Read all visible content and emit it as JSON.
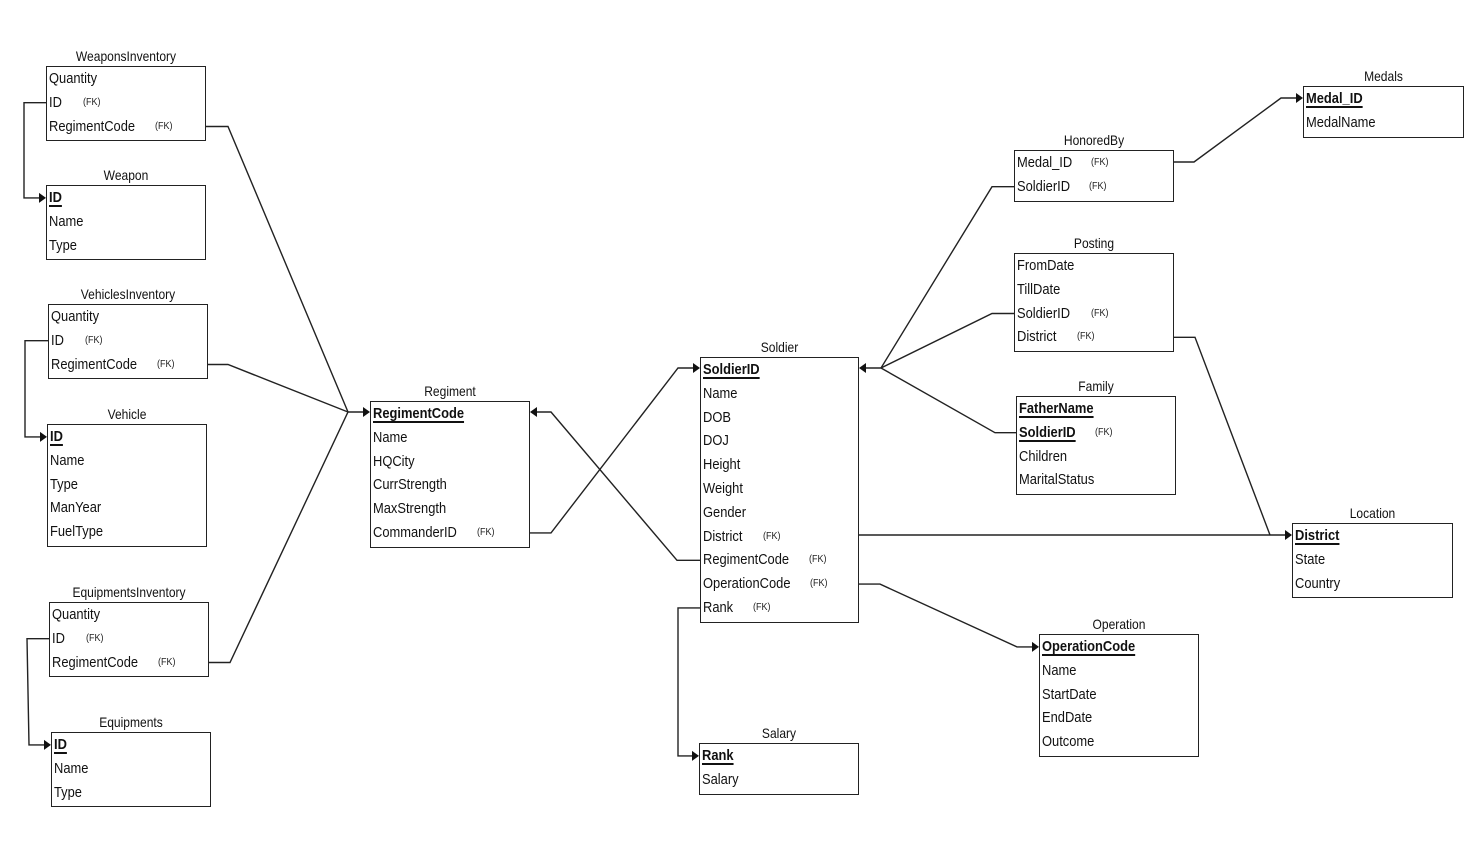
{
  "diagram": {
    "type": "entity-relationship",
    "fk_marker": "(FK)",
    "entities": [
      {
        "id": "weaponsinventory",
        "title": "WeaponsInventory",
        "attributes": [
          {
            "name": "Quantity",
            "pk": false,
            "fk": false
          },
          {
            "name": "ID",
            "pk": false,
            "fk": true
          },
          {
            "name": "RegimentCode",
            "pk": false,
            "fk": true
          }
        ]
      },
      {
        "id": "weapon",
        "title": "Weapon",
        "attributes": [
          {
            "name": "ID",
            "pk": true,
            "fk": false
          },
          {
            "name": "Name",
            "pk": false,
            "fk": false
          },
          {
            "name": "Type",
            "pk": false,
            "fk": false
          }
        ]
      },
      {
        "id": "vehiclesinventory",
        "title": "VehiclesInventory",
        "attributes": [
          {
            "name": "Quantity",
            "pk": false,
            "fk": false
          },
          {
            "name": "ID",
            "pk": false,
            "fk": true
          },
          {
            "name": "RegimentCode",
            "pk": false,
            "fk": true
          }
        ]
      },
      {
        "id": "vehicle",
        "title": "Vehicle",
        "attributes": [
          {
            "name": "ID",
            "pk": true,
            "fk": false
          },
          {
            "name": "Name",
            "pk": false,
            "fk": false
          },
          {
            "name": "Type",
            "pk": false,
            "fk": false
          },
          {
            "name": "ManYear",
            "pk": false,
            "fk": false
          },
          {
            "name": "FuelType",
            "pk": false,
            "fk": false
          }
        ]
      },
      {
        "id": "equipmentsinventory",
        "title": "EquipmentsInventory",
        "attributes": [
          {
            "name": "Quantity",
            "pk": false,
            "fk": false
          },
          {
            "name": "ID",
            "pk": false,
            "fk": true
          },
          {
            "name": "RegimentCode",
            "pk": false,
            "fk": true
          }
        ]
      },
      {
        "id": "equipments",
        "title": "Equipments",
        "attributes": [
          {
            "name": "ID",
            "pk": true,
            "fk": false
          },
          {
            "name": "Name",
            "pk": false,
            "fk": false
          },
          {
            "name": "Type",
            "pk": false,
            "fk": false
          }
        ]
      },
      {
        "id": "regiment",
        "title": "Regiment",
        "attributes": [
          {
            "name": "RegimentCode",
            "pk": true,
            "fk": false
          },
          {
            "name": "Name",
            "pk": false,
            "fk": false
          },
          {
            "name": "HQCity",
            "pk": false,
            "fk": false
          },
          {
            "name": "CurrStrength",
            "pk": false,
            "fk": false
          },
          {
            "name": "MaxStrength",
            "pk": false,
            "fk": false
          },
          {
            "name": "CommanderID",
            "pk": false,
            "fk": true
          }
        ]
      },
      {
        "id": "soldier",
        "title": "Soldier",
        "attributes": [
          {
            "name": "SoldierID",
            "pk": true,
            "fk": false
          },
          {
            "name": "Name",
            "pk": false,
            "fk": false
          },
          {
            "name": "DOB",
            "pk": false,
            "fk": false
          },
          {
            "name": "DOJ",
            "pk": false,
            "fk": false
          },
          {
            "name": "Height",
            "pk": false,
            "fk": false
          },
          {
            "name": "Weight",
            "pk": false,
            "fk": false
          },
          {
            "name": "Gender",
            "pk": false,
            "fk": false
          },
          {
            "name": "District",
            "pk": false,
            "fk": true
          },
          {
            "name": "RegimentCode",
            "pk": false,
            "fk": true
          },
          {
            "name": "OperationCode",
            "pk": false,
            "fk": true
          },
          {
            "name": "Rank",
            "pk": false,
            "fk": true
          }
        ]
      },
      {
        "id": "salary",
        "title": "Salary",
        "attributes": [
          {
            "name": "Rank",
            "pk": true,
            "fk": false
          },
          {
            "name": "Salary",
            "pk": false,
            "fk": false
          }
        ]
      },
      {
        "id": "honoredby",
        "title": "HonoredBy",
        "attributes": [
          {
            "name": "Medal_ID",
            "pk": false,
            "fk": true
          },
          {
            "name": "SoldierID",
            "pk": false,
            "fk": true
          }
        ]
      },
      {
        "id": "medals",
        "title": "Medals",
        "attributes": [
          {
            "name": "Medal_ID",
            "pk": true,
            "fk": false
          },
          {
            "name": "MedalName",
            "pk": false,
            "fk": false
          }
        ]
      },
      {
        "id": "posting",
        "title": "Posting",
        "attributes": [
          {
            "name": "FromDate",
            "pk": false,
            "fk": false
          },
          {
            "name": "TillDate",
            "pk": false,
            "fk": false
          },
          {
            "name": "SoldierID",
            "pk": false,
            "fk": true
          },
          {
            "name": "District",
            "pk": false,
            "fk": true
          }
        ]
      },
      {
        "id": "family",
        "title": "Family",
        "attributes": [
          {
            "name": "FatherName",
            "pk": true,
            "fk": false
          },
          {
            "name": "SoldierID",
            "pk": true,
            "fk": true
          },
          {
            "name": "Children",
            "pk": false,
            "fk": false
          },
          {
            "name": "MaritalStatus",
            "pk": false,
            "fk": false
          }
        ]
      },
      {
        "id": "location",
        "title": "Location",
        "attributes": [
          {
            "name": "District",
            "pk": true,
            "fk": false
          },
          {
            "name": "State",
            "pk": false,
            "fk": false
          },
          {
            "name": "Country",
            "pk": false,
            "fk": false
          }
        ]
      },
      {
        "id": "operation",
        "title": "Operation",
        "attributes": [
          {
            "name": "OperationCode",
            "pk": true,
            "fk": false
          },
          {
            "name": "Name",
            "pk": false,
            "fk": false
          },
          {
            "name": "StartDate",
            "pk": false,
            "fk": false
          },
          {
            "name": "EndDate",
            "pk": false,
            "fk": false
          },
          {
            "name": "Outcome",
            "pk": false,
            "fk": false
          }
        ]
      }
    ],
    "relationships": [
      {
        "from": "weaponsinventory.ID",
        "to": "weapon.ID"
      },
      {
        "from": "weaponsinventory.RegimentCode",
        "to": "regiment.RegimentCode"
      },
      {
        "from": "vehiclesinventory.ID",
        "to": "vehicle.ID"
      },
      {
        "from": "vehiclesinventory.RegimentCode",
        "to": "regiment.RegimentCode"
      },
      {
        "from": "equipmentsinventory.ID",
        "to": "equipments.ID"
      },
      {
        "from": "equipmentsinventory.RegimentCode",
        "to": "regiment.RegimentCode"
      },
      {
        "from": "regiment.CommanderID",
        "to": "soldier.SoldierID"
      },
      {
        "from": "soldier.RegimentCode",
        "to": "regiment.RegimentCode"
      },
      {
        "from": "soldier.Rank",
        "to": "salary.Rank"
      },
      {
        "from": "soldier.District",
        "to": "location.District"
      },
      {
        "from": "soldier.OperationCode",
        "to": "operation.OperationCode"
      },
      {
        "from": "honoredby.SoldierID",
        "to": "soldier.SoldierID"
      },
      {
        "from": "honoredby.Medal_ID",
        "to": "medals.Medal_ID"
      },
      {
        "from": "posting.SoldierID",
        "to": "soldier.SoldierID"
      },
      {
        "from": "posting.District",
        "to": "location.District"
      },
      {
        "from": "family.SoldierID",
        "to": "soldier.SoldierID"
      }
    ]
  }
}
